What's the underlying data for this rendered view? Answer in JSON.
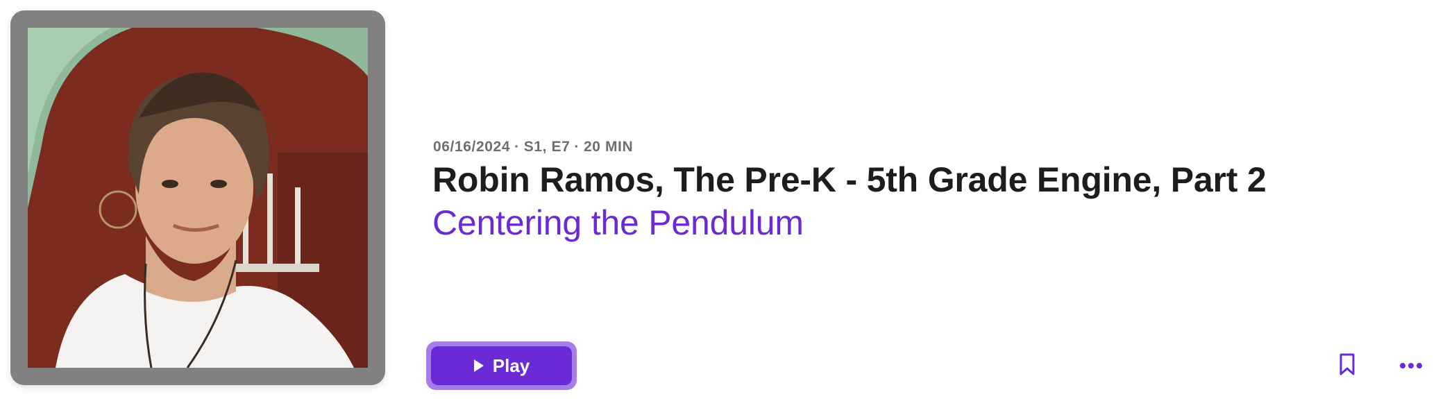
{
  "episode": {
    "date": "06/16/2024",
    "season_episode": "S1, E7",
    "duration": "20 MIN",
    "separator": "·",
    "title": "Robin Ramos, The Pre-K - 5th Grade Engine, Part 2",
    "show_name": "Centering the Pendulum"
  },
  "actions": {
    "play_label": "Play",
    "bookmark_icon": "bookmark-icon",
    "more_icon": "more-icon"
  },
  "colors": {
    "accent": "#6a2bd6",
    "accent_ring": "#a97de9",
    "title": "#1d1d1f",
    "meta": "#6e6e73",
    "artwork_frame": "#818181"
  }
}
